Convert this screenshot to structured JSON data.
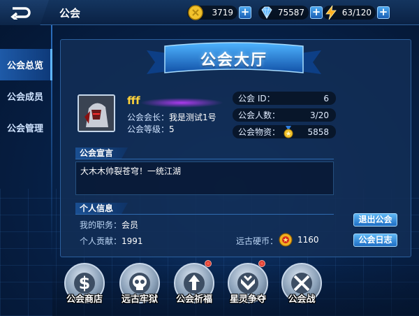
{
  "header": {
    "title": "公会",
    "coins": "3719",
    "diamonds": "75587",
    "stamina": "63/120"
  },
  "sidebar": {
    "items": [
      {
        "label": "公会总览",
        "active": true
      },
      {
        "label": "公会成员",
        "active": false
      },
      {
        "label": "公会管理",
        "active": false
      }
    ]
  },
  "banner": {
    "title": "公会大厅"
  },
  "guild": {
    "name": "fff",
    "leader_label": "公会会长：",
    "leader_value": "我是测试1号",
    "level_label": "公会等级：",
    "level_value": "5",
    "stats": [
      {
        "label": "公会 ID：",
        "value": "6"
      },
      {
        "label": "公会人数：",
        "value": "3/20"
      },
      {
        "label": "公会物资：",
        "value": "5858"
      }
    ]
  },
  "notice": {
    "heading": "公会宣言",
    "text": "大木木帅裂苍穹！一统江湖"
  },
  "personal": {
    "heading": "个人信息",
    "role_label": "我的职务：",
    "role_value": "会员",
    "contrib_label": "个人贡献：",
    "contrib_value": "1991",
    "coin_label": "远古硬币：",
    "coin_value": "1160",
    "leave_button": "退出公会",
    "log_button": "公会日志"
  },
  "features": [
    {
      "label": "公会商店",
      "icon": "dollar-icon",
      "badge": false
    },
    {
      "label": "远古牢狱",
      "icon": "skull-icon",
      "badge": false
    },
    {
      "label": "公会祈福",
      "icon": "pray-icon",
      "badge": true
    },
    {
      "label": "星灵争夺",
      "icon": "star-spirit-icon",
      "badge": true
    },
    {
      "label": "公会战",
      "icon": "crossed-swords-icon",
      "badge": false
    }
  ],
  "colors": {
    "accent": "#1e6ec4",
    "gold_text": "#ffd23a",
    "background": "#07224a"
  }
}
